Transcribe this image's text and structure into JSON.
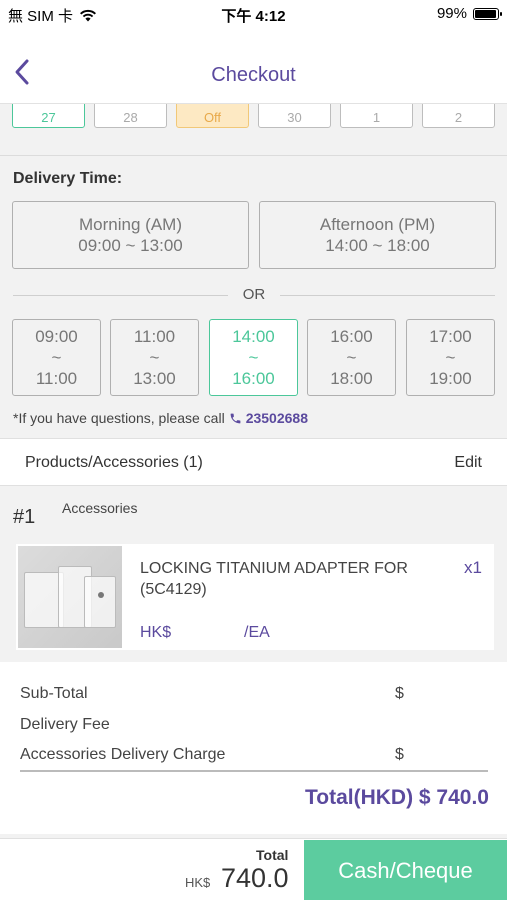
{
  "status_bar": {
    "carrier": "無 SIM 卡",
    "time": "下午 4:12",
    "battery": "99%",
    "battery_level": 0.99
  },
  "header": {
    "title": "Checkout"
  },
  "dates": [
    {
      "label": "27",
      "state": "selected"
    },
    {
      "label": "28",
      "state": "normal"
    },
    {
      "label": "Off",
      "state": "off"
    },
    {
      "label": "30",
      "state": "normal"
    },
    {
      "label": "1",
      "state": "normal"
    },
    {
      "label": "2",
      "state": "normal"
    }
  ],
  "delivery": {
    "heading": "Delivery Time:",
    "periods": [
      {
        "name": "Morning (AM)",
        "range": "09:00 ~ 13:00"
      },
      {
        "name": "Afternoon (PM)",
        "range": "14:00 ~ 18:00"
      }
    ],
    "or_label": "OR",
    "slots": [
      {
        "start": "09:00",
        "sep": "~",
        "end": "11:00",
        "selected": false
      },
      {
        "start": "11:00",
        "sep": "~",
        "end": "13:00",
        "selected": false
      },
      {
        "start": "14:00",
        "sep": "~",
        "end": "16:00",
        "selected": true
      },
      {
        "start": "16:00",
        "sep": "~",
        "end": "18:00",
        "selected": false
      },
      {
        "start": "17:00",
        "sep": "~",
        "end": "19:00",
        "selected": false
      }
    ],
    "note": "*If you have questions, please call",
    "phone": "23502688"
  },
  "products": {
    "header": "Products/Accessories (1)",
    "edit_label": "Edit",
    "items": [
      {
        "index": "#1",
        "category": "Accessories",
        "name": "LOCKING TITANIUM ADAPTER FOR (5C4129)",
        "qty": "x1",
        "price_currency": "HK$",
        "unit": "/EA"
      }
    ]
  },
  "summary": {
    "subtotal_label": "Sub-Total",
    "subtotal_currency": "$",
    "delivery_fee_label": "Delivery Fee",
    "accessories_charge_label": "Accessories Delivery Charge",
    "accessories_charge_currency": "$",
    "total": "Total(HKD) $ 740.0"
  },
  "footer": {
    "total_label": "Total",
    "currency": "HK$",
    "amount": "740.0",
    "pay_button": "Cash/Cheque"
  },
  "colors": {
    "accent": "#5b4a9e",
    "selected": "#4cc79a",
    "pay_button": "#5ccc9f",
    "off_day": "#fde9c3"
  }
}
